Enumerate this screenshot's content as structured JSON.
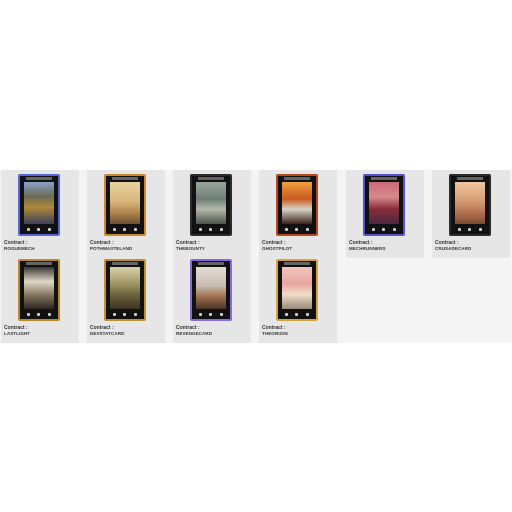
{
  "contract_label": "Contract :",
  "cards": [
    {
      "name": "ROGUEMECH",
      "border": "#5566dd",
      "art": "linear-gradient(180deg,#8aa0c8 0%,#6c6a54 35%,#b08a3a 60%,#3a3f58 100%)"
    },
    {
      "name": "POTHWASTELAND",
      "border": "#c98a2a",
      "art": "linear-gradient(180deg,#e9d3a0 0%,#d8b77c 45%,#b88a52 70%,#6b5030 100%)"
    },
    {
      "name": "THEBOUNTY",
      "border": "#2b2b2b",
      "art": "linear-gradient(180deg,#9aa89c 0%,#6e7d74 40%,#b4b8aa 65%,#4b544e 100%)"
    },
    {
      "name": "GHOSTPILOT",
      "border": "#b8471f",
      "art": "linear-gradient(180deg,#f0a040 0%,#c85a1e 40%,#d7d2c8 65%,#3a2218 100%)"
    },
    {
      "name": "MECHRUNNERS",
      "border": "#5a4fcf",
      "art": "linear-gradient(180deg,#c86a78 0%,#d88a8a 35%,#8a2a3a 65%,#4a2a3e 100%)"
    },
    {
      "name": "CRUSADECARD",
      "border": "#2a2a2a",
      "art": "linear-gradient(180deg,#f0c7a0 0%,#d69b72 45%,#b77552 70%,#7a4a30 100%)"
    },
    {
      "name": "LASTLIGHT",
      "border": "#b88a2a",
      "art": "linear-gradient(180deg,#3a3632 0%,#e0d8c8 35%,#8a7a64 65%,#2a241e 100%)"
    },
    {
      "name": "DEVSTATCARD",
      "border": "#c0922e",
      "art": "linear-gradient(180deg,#d8d0a8 0%,#a09664 40%,#6e6440 65%,#3a3220 100%)"
    },
    {
      "name": "REVENGECARD",
      "border": "#8a6ae0",
      "art": "linear-gradient(180deg,#e4ddd6 0%,#c8bcb0 45%,#a07050 70%,#4a3426 100%)"
    },
    {
      "name": "THEORIGIN",
      "border": "#d6a43a",
      "art": "linear-gradient(180deg,#f2c6c0 0%,#e8a6a0 40%,#f0dcc8 65%,#9a8a7a 100%)"
    }
  ]
}
